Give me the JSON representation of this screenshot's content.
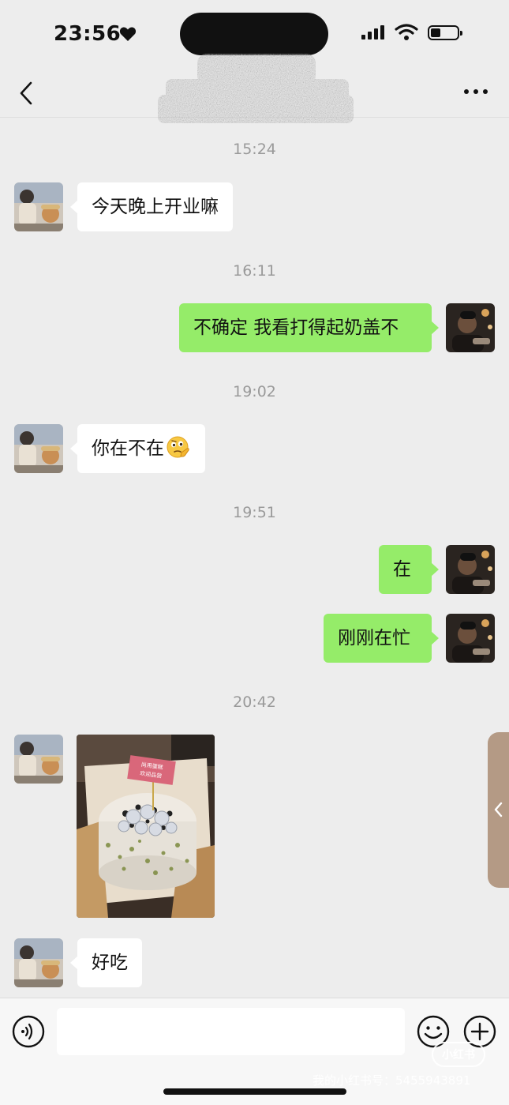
{
  "status_bar": {
    "time": "23:56"
  },
  "messages": [
    {
      "timestamp": "15:24"
    },
    {
      "sender": "contact",
      "text": "今天晚上开业嘛"
    },
    {
      "timestamp": "16:11"
    },
    {
      "sender": "me",
      "text": "不确定 我看打得起奶盖不"
    },
    {
      "timestamp": "19:02"
    },
    {
      "sender": "contact",
      "text": "你在不在",
      "emoji": "thinking-face"
    },
    {
      "timestamp": "19:51"
    },
    {
      "sender": "me",
      "text": "在"
    },
    {
      "sender": "me",
      "text": "刚刚在忙"
    },
    {
      "timestamp": "20:42"
    },
    {
      "sender": "contact",
      "type": "image",
      "image_sign_text": [
        "尚用蛋糕",
        "欢迎品尝"
      ]
    },
    {
      "sender": "contact",
      "text": "好吃"
    }
  ],
  "composer": {
    "placeholder": ""
  },
  "watermark": {
    "logo": "小红书",
    "text": "我的小红书号：5455943891"
  },
  "colors": {
    "background": "#ededed",
    "outgoing_bubble": "#95ec69",
    "incoming_bubble": "#ffffff",
    "side_tab": "#b49a85"
  },
  "icons": [
    "chevron-left-icon",
    "more-icon",
    "voice-icon",
    "emoji-icon",
    "plus-icon",
    "heart-icon",
    "signal-icon",
    "wifi-icon",
    "battery-icon"
  ]
}
